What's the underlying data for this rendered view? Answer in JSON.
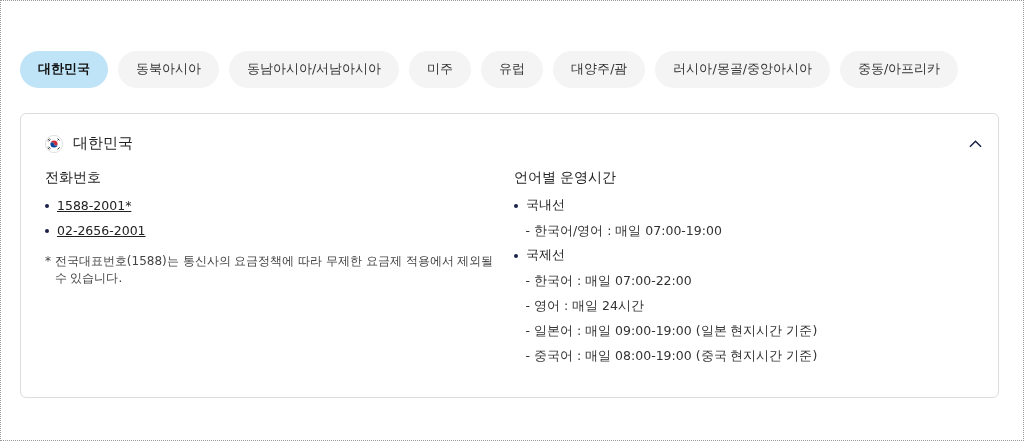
{
  "tabs": [
    {
      "label": "대한민국",
      "selected": true
    },
    {
      "label": "동북아시아",
      "selected": false
    },
    {
      "label": "동남아시아/서남아시아",
      "selected": false
    },
    {
      "label": "미주",
      "selected": false
    },
    {
      "label": "유럽",
      "selected": false
    },
    {
      "label": "대양주/괌",
      "selected": false
    },
    {
      "label": "러시아/몽골/중앙아시아",
      "selected": false
    },
    {
      "label": "중동/아프리카",
      "selected": false
    }
  ],
  "panel": {
    "title": "대한민국",
    "expanded": true,
    "phone": {
      "heading": "전화번호",
      "numbers": [
        "1588-2001*",
        "02-2656-2001"
      ],
      "note": "* 전국대표번호(1588)는 통신사의 요금정책에 따라 무제한 요금제 적용에서 제외될 수 있습니다."
    },
    "hours": {
      "heading": "언어별 운영시간",
      "groups": [
        {
          "label": "국내선",
          "children": [
            "- 한국어/영어 : 매일 07:00-19:00"
          ]
        },
        {
          "label": "국제선",
          "children": [
            "- 한국어 :  매일 07:00-22:00",
            "- 영어 : 매일 24시간",
            "- 일본어 : 매일 09:00-19:00 (일본 현지시간 기준)",
            "- 중국어 : 매일 08:00-19:00 (중국 현지시간 기준)"
          ]
        }
      ]
    }
  }
}
